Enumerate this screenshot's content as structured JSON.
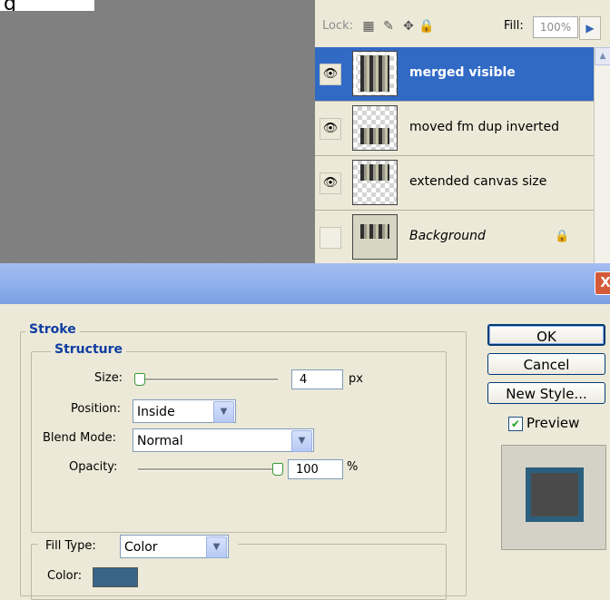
{
  "canvas": {
    "fragment_text": "g"
  },
  "layers": {
    "lock_label": "Lock:",
    "fill_label": "Fill:",
    "fill_value": "100%",
    "items": [
      {
        "name": "merged visible",
        "visible": true,
        "selected": true
      },
      {
        "name": "moved fm dup inverted",
        "visible": true,
        "selected": false
      },
      {
        "name": "extended canvas size",
        "visible": true,
        "selected": false
      },
      {
        "name": "Background",
        "visible": false,
        "selected": false
      }
    ]
  },
  "dialog": {
    "close_label": "X",
    "stroke_legend": "Stroke",
    "structure_legend": "Structure",
    "size_label": "Size:",
    "size_value": "4",
    "size_unit": "px",
    "position_label": "Position:",
    "position_value": "Inside",
    "blend_label": "Blend Mode:",
    "blend_value": "Normal",
    "opacity_label": "Opacity:",
    "opacity_value": "100",
    "opacity_unit": "%",
    "fill_type_label": "Fill Type:",
    "fill_type_value": "Color",
    "color_label": "Color:",
    "ok_label": "OK",
    "cancel_label": "Cancel",
    "new_style_label": "New Style...",
    "preview_label": "Preview",
    "preview_checked": true,
    "stroke_color": "#3a6588"
  }
}
